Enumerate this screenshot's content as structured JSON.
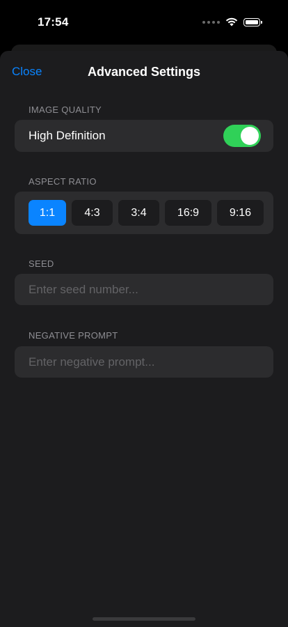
{
  "status_bar": {
    "time": "17:54",
    "icons": [
      "signal-dots-icon",
      "wifi-icon",
      "battery-icon"
    ]
  },
  "nav": {
    "close_label": "Close",
    "title": "Advanced Settings"
  },
  "image_quality": {
    "section_label": "IMAGE QUALITY",
    "option_label": "High Definition",
    "enabled": true
  },
  "aspect_ratio": {
    "section_label": "ASPECT RATIO",
    "options": [
      "1:1",
      "4:3",
      "3:4",
      "16:9",
      "9:16"
    ],
    "selected": "1:1"
  },
  "seed": {
    "section_label": "SEED",
    "placeholder": "Enter seed number...",
    "value": ""
  },
  "negative_prompt": {
    "section_label": "NEGATIVE PROMPT",
    "placeholder": "Enter negative prompt...",
    "value": ""
  },
  "colors": {
    "accent": "#0a84ff",
    "toggle_on": "#30d158",
    "sheet_bg": "#1c1c1e",
    "card_bg": "#2c2c2e"
  }
}
